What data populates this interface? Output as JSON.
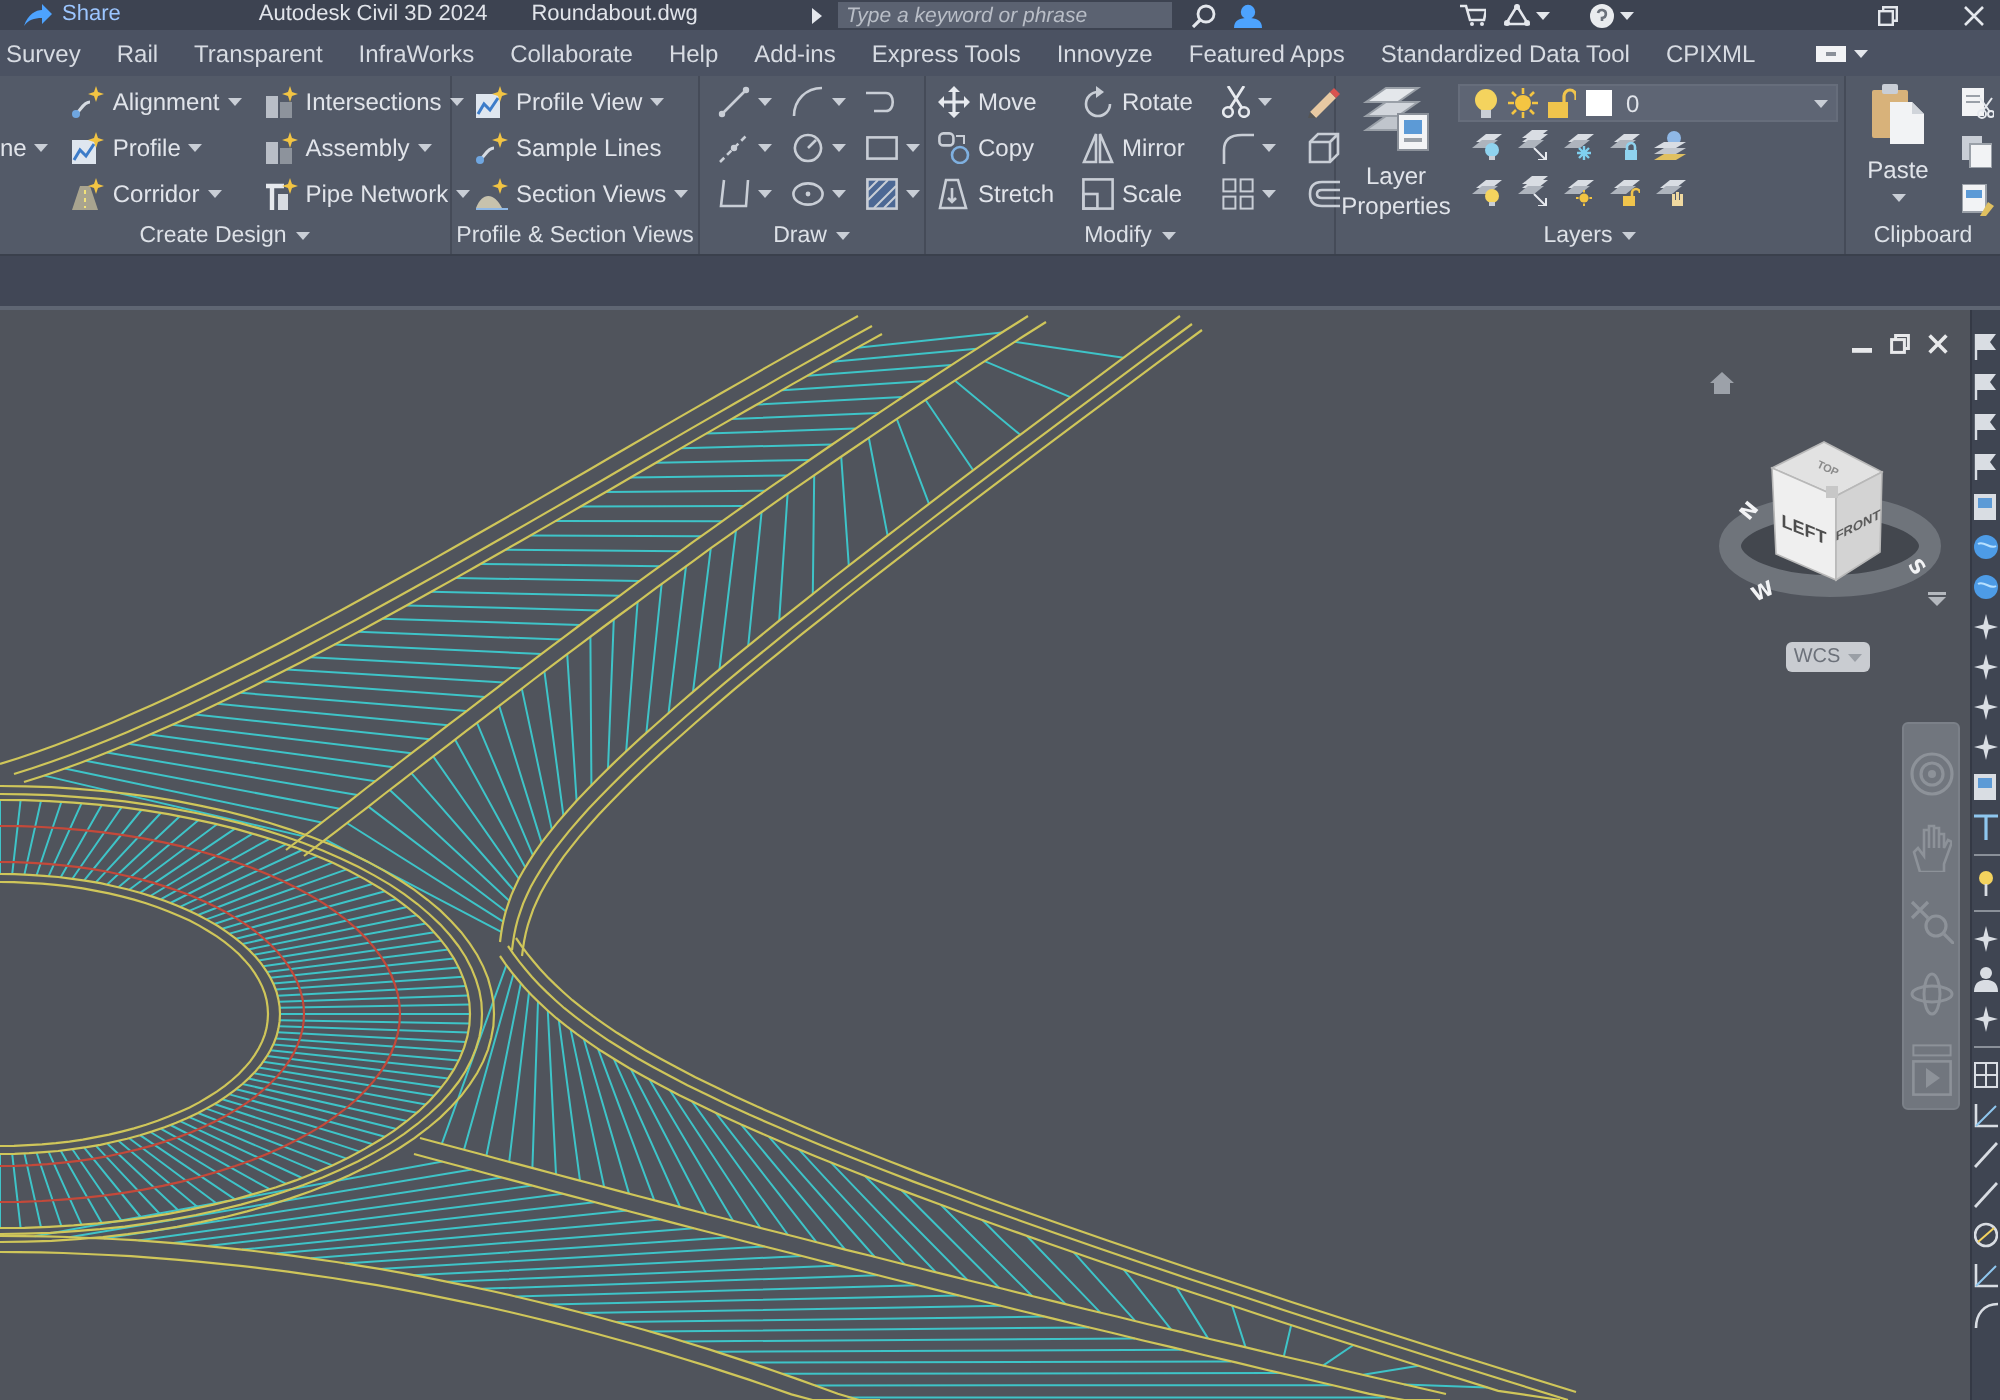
{
  "title_bar": {
    "share": "Share",
    "app_title": "Autodesk Civil 3D 2024",
    "file_name": "Roundabout.dwg",
    "search": {
      "placeholder": "Type a keyword or phrase"
    }
  },
  "ribbon_tabs": [
    {
      "label": "Survey",
      "selected": false
    },
    {
      "label": "Rail",
      "selected": false
    },
    {
      "label": "Transparent",
      "selected": false
    },
    {
      "label": "InfraWorks",
      "selected": false
    },
    {
      "label": "Collaborate",
      "selected": false
    },
    {
      "label": "Help",
      "selected": false
    },
    {
      "label": "Add-ins",
      "selected": false
    },
    {
      "label": "Express Tools",
      "selected": false
    },
    {
      "label": "Innovyze",
      "selected": false
    },
    {
      "label": "Featured Apps",
      "selected": false
    },
    {
      "label": "Standardized Data Tool",
      "selected": false
    },
    {
      "label": "CPIXML",
      "selected": false
    }
  ],
  "ribbon_panels": [
    {
      "kind": "tools",
      "title": "Create Design",
      "menu": true,
      "columns": [
        [
          {
            "label": "ne",
            "menu": true
          }
        ],
        [
          {
            "label": "Alignment",
            "menu": true
          },
          {
            "label": "Profile",
            "menu": true
          },
          {
            "label": "Corridor",
            "menu": true
          }
        ],
        [
          {
            "label": "Intersections",
            "menu": true
          },
          {
            "label": "Assembly",
            "menu": true
          },
          {
            "label": "Pipe Network",
            "menu": true
          }
        ]
      ]
    },
    {
      "kind": "tools",
      "title": "Profile & Section Views",
      "menu": false,
      "columns": [
        [
          {
            "label": "Profile View",
            "menu": true
          },
          {
            "label": "Sample Lines",
            "menu": false
          },
          {
            "label": "Section Views",
            "menu": true
          }
        ]
      ]
    },
    {
      "kind": "tools",
      "title": "Draw",
      "menu": true,
      "columns": [
        [
          {
            "menu": true
          },
          {
            "menu": true
          },
          {
            "menu": true
          }
        ],
        [
          {
            "menu": true
          },
          {
            "menu": true
          },
          {
            "menu": true
          }
        ],
        [
          {
            "menu": false
          },
          {
            "menu": true
          },
          {
            "menu": true
          }
        ]
      ]
    },
    {
      "kind": "tools",
      "title": "Modify",
      "menu": true,
      "columns": [
        [
          {
            "label": "Move",
            "menu": false
          },
          {
            "label": "Copy",
            "menu": false
          },
          {
            "label": "Stretch",
            "menu": false
          }
        ],
        [
          {
            "label": "Rotate",
            "menu": false
          },
          {
            "label": "Mirror",
            "menu": false
          },
          {
            "label": "Scale",
            "menu": false
          }
        ],
        [
          {
            "menu": true
          },
          {
            "menu": true
          },
          {
            "menu": true
          }
        ],
        [
          {
            "menu": false
          },
          {
            "menu": false
          },
          {
            "menu": false
          }
        ]
      ]
    },
    {
      "kind": "layers",
      "title": "Layers",
      "menu": true,
      "button": {
        "label": "Layer Properties"
      },
      "layer": {
        "value": "0"
      }
    },
    {
      "kind": "clipboard",
      "title": "Clipboard",
      "menu": false,
      "button": {
        "label": "Paste",
        "menu": true
      }
    }
  ],
  "viewport": {
    "viewcube": {
      "faces": [
        "TOP",
        "LEFT",
        "FRONT"
      ],
      "compass": [
        "N",
        "W",
        "S"
      ]
    },
    "ucs": {
      "label": "WCS",
      "menu": true
    }
  }
}
